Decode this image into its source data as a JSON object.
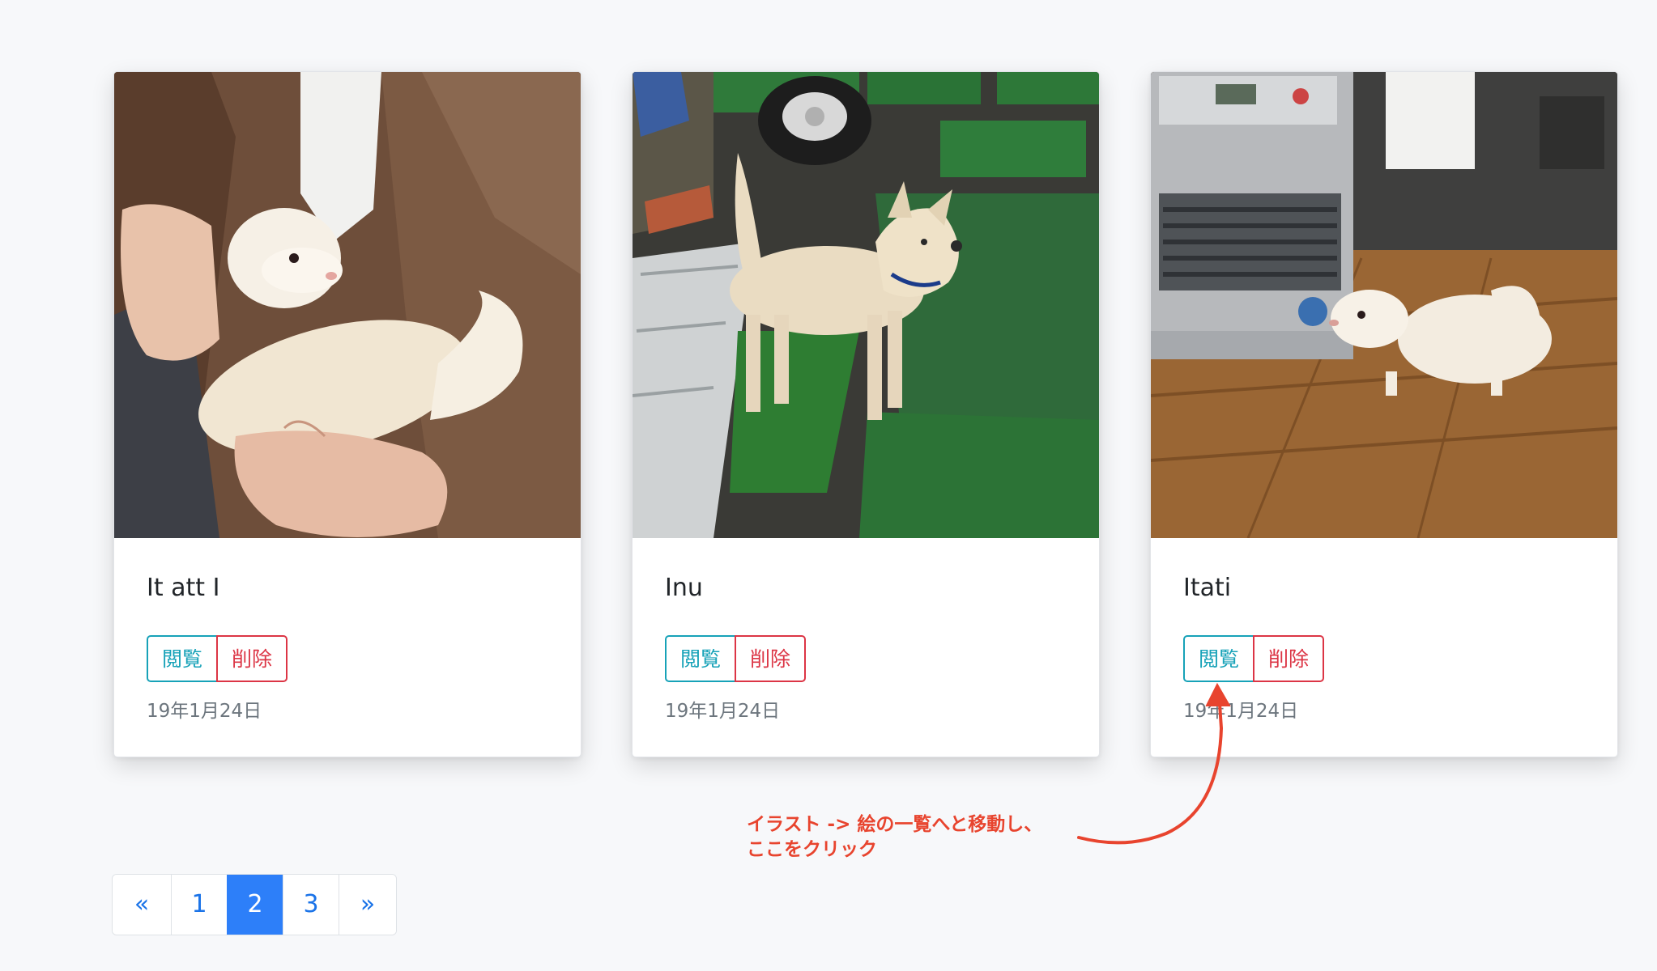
{
  "cards": [
    {
      "title": "It att I",
      "view_label": "閲覧",
      "delete_label": "削除",
      "date": "19年1月24日"
    },
    {
      "title": "Inu",
      "view_label": "閲覧",
      "delete_label": "削除",
      "date": "19年1月24日"
    },
    {
      "title": "Itati",
      "view_label": "閲覧",
      "delete_label": "削除",
      "date": "19年1月24日"
    }
  ],
  "annotation": {
    "line1": "イラスト -> 絵の一覧へと移動し、",
    "line2": "ここをクリック",
    "color": "#e8442e"
  },
  "pagination": {
    "prev": "«",
    "pages": [
      "1",
      "2",
      "3"
    ],
    "active": "2",
    "next": "»"
  },
  "colors": {
    "view": "#17a2b8",
    "delete": "#dc3545",
    "link": "#1a73e8",
    "active_page": "#2d7ff9"
  }
}
